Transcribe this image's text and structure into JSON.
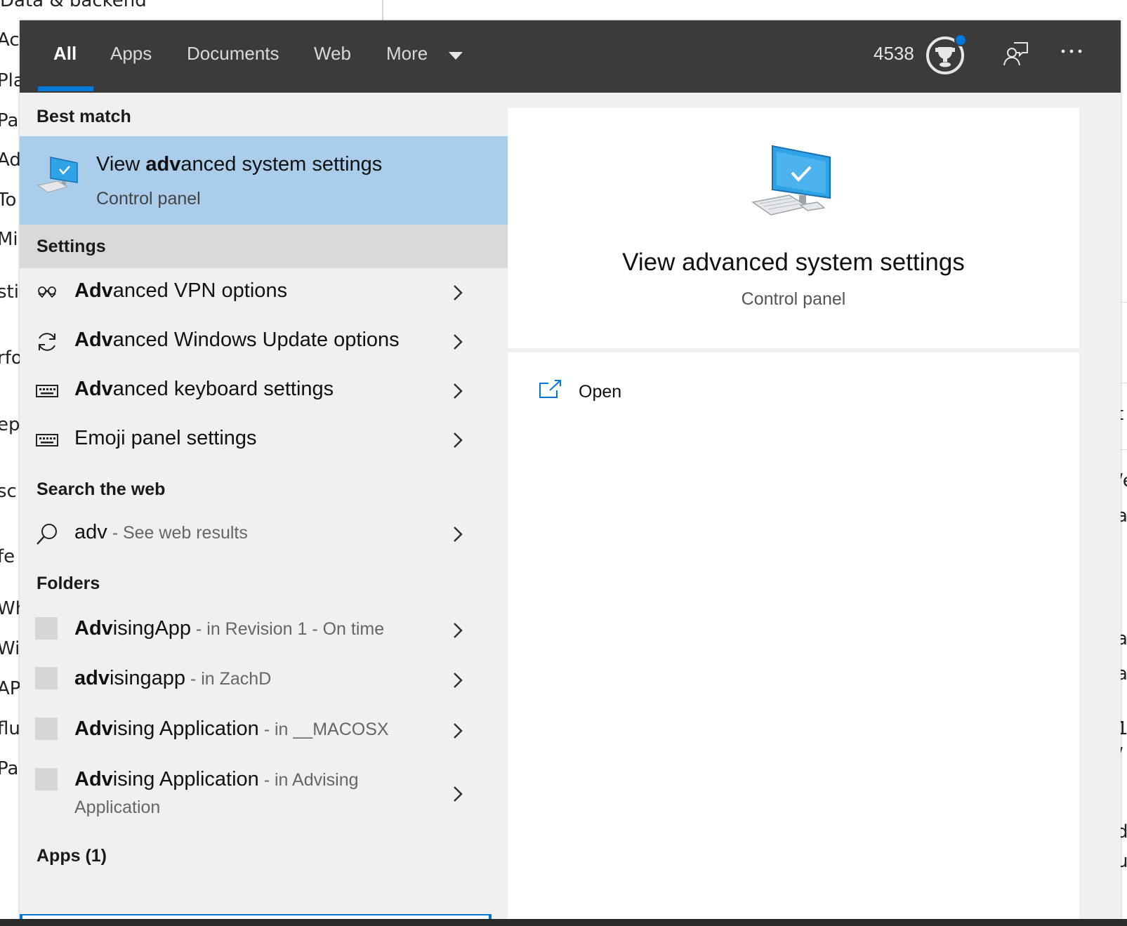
{
  "background": {
    "top_text": "Data & backend",
    "left_fragments": [
      "Ac",
      "Pla",
      "Pa",
      "Ad",
      "To",
      "Mi",
      "sti",
      "rfo",
      "epl",
      "sc",
      "fe",
      "Wh",
      "Wi",
      "AP",
      "flu",
      "Pa"
    ],
    "right_fragments": [
      "t",
      "/e",
      "a",
      "a",
      "a",
      ":",
      "1",
      "/",
      "d",
      "u"
    ]
  },
  "topbar": {
    "tabs": [
      {
        "label": "All",
        "active": true
      },
      {
        "label": "Apps"
      },
      {
        "label": "Documents"
      },
      {
        "label": "Web"
      },
      {
        "label": "More"
      }
    ],
    "points": "4538",
    "accent_color": "#0078d7"
  },
  "results": {
    "best_match": {
      "heading": "Best match",
      "title_pre": "View ",
      "title_bold": "adv",
      "title_post": "anced system settings",
      "subtitle": "Control panel",
      "icon": "computer-check-icon"
    },
    "settings": {
      "heading": "Settings",
      "items": [
        {
          "bold": "Adv",
          "rest": "anced VPN options",
          "icon": "vpn-icon"
        },
        {
          "bold": "Adv",
          "rest": "anced Windows Update options",
          "icon": "sync-icon"
        },
        {
          "bold": "Adv",
          "rest": "anced keyboard settings",
          "icon": "keyboard-icon"
        },
        {
          "bold": "",
          "rest": "Emoji panel settings",
          "icon": "keyboard-icon"
        }
      ]
    },
    "web": {
      "heading": "Search the web",
      "query": "adv",
      "suffix": " - See web results",
      "icon": "search-icon"
    },
    "folders": {
      "heading": "Folders",
      "items": [
        {
          "bold": "Adv",
          "rest": "isingApp",
          "suffix": " - in Revision 1 - On time"
        },
        {
          "bold": "adv",
          "rest": "isingapp",
          "suffix": " - in ZachD"
        },
        {
          "bold": "Adv",
          "rest": "ising Application",
          "suffix": " - in __MACOSX"
        },
        {
          "bold": "Adv",
          "rest": "ising Application",
          "suffix": " - in Advising",
          "suffix_line2": "Application"
        }
      ]
    },
    "apps": {
      "heading": "Apps (1)"
    }
  },
  "preview": {
    "title": "View advanced system settings",
    "subtitle": "Control panel",
    "open_label": "Open",
    "icon": "computer-check-icon"
  }
}
